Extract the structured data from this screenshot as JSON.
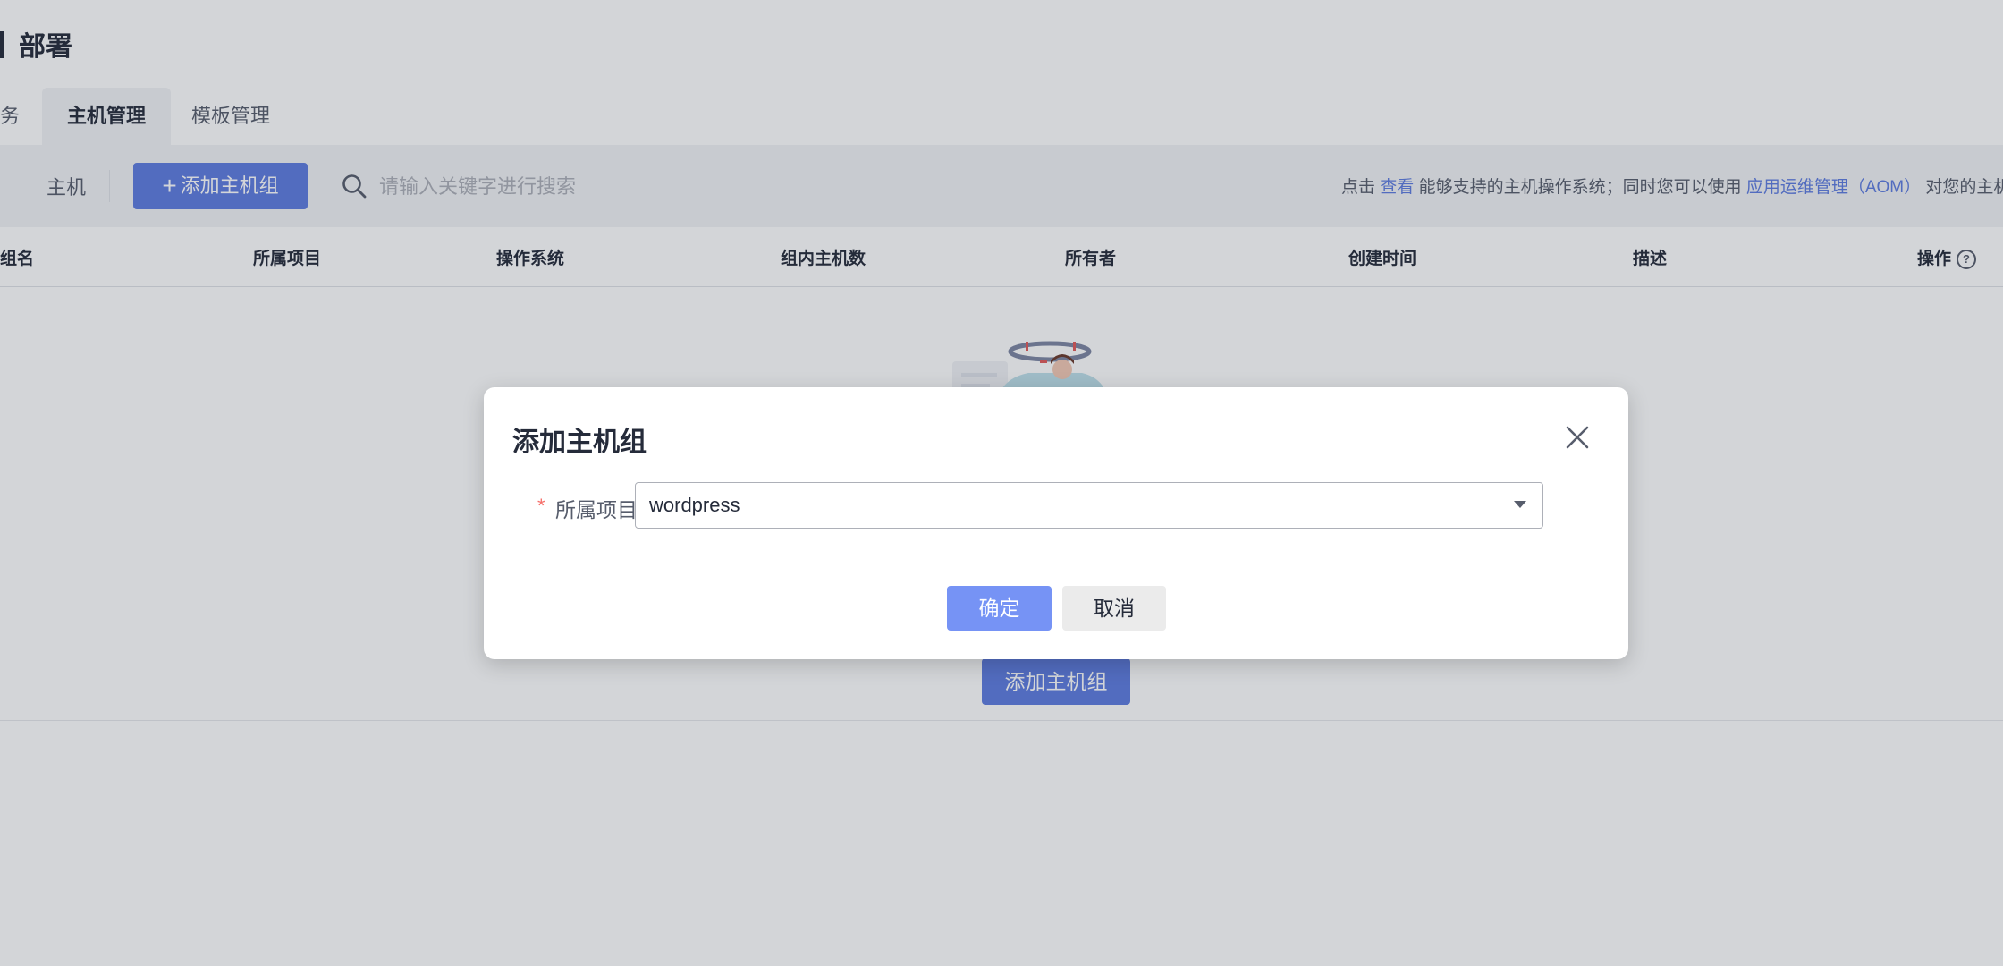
{
  "page": {
    "title": "部署"
  },
  "tabs": [
    {
      "label": "务",
      "active": false
    },
    {
      "label": "主机管理",
      "active": true
    },
    {
      "label": "模板管理",
      "active": false
    }
  ],
  "toolbar": {
    "host_label": "主机",
    "add_group_plus": "+",
    "add_group_label": "添加主机组",
    "search_placeholder": "请输入关键字进行搜索",
    "notice": {
      "prefix": "点击 ",
      "link_view": "查看",
      "middle": " 能够支持的主机操作系统；同时您可以使用 ",
      "link_aom": "应用运维管理（AOM）",
      "suffix": " 对您的主机"
    }
  },
  "table": {
    "headers": [
      "组名",
      "所属项目",
      "操作系统",
      "组内主机数",
      "所有者",
      "创建时间",
      "描述",
      "操作"
    ],
    "help_icon_label": "?"
  },
  "empty_state": {
    "add_button_label": "添加主机组"
  },
  "dialog": {
    "title": "添加主机组",
    "field": {
      "required_mark": "*",
      "label": "所属项目",
      "value": "wordpress"
    },
    "ok_label": "确定",
    "cancel_label": "取消"
  },
  "icons": {
    "search": "search-icon",
    "close": "close-icon",
    "caret": "caret-down-icon",
    "help": "help-circle-icon"
  },
  "colors": {
    "primary": "#5e7ce0",
    "primary_light": "#7693f5",
    "required": "#f66f6a",
    "text": "#252b3a"
  }
}
